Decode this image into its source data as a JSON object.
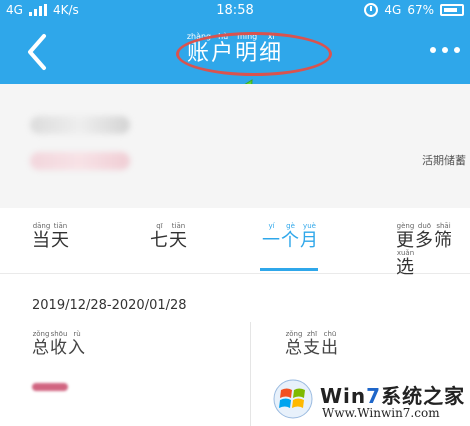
{
  "status_bar": {
    "network_left": "4G",
    "speed": "4K/s",
    "time": "18:58",
    "network_right": "4G",
    "battery": "67%"
  },
  "header": {
    "title": "账户明细",
    "title_pinyin": [
      "zhàng",
      "hù",
      "míng",
      "xì"
    ],
    "title_chars": [
      "账",
      "户",
      "明",
      "细"
    ],
    "accent": "#2fa7ea",
    "icons": {
      "back": "chevron-left-icon",
      "more": "more-dots-icon"
    }
  },
  "account_card": {
    "label": "活期储蓄"
  },
  "tabs": [
    {
      "chars": [
        "当",
        "天"
      ],
      "pinyin": [
        "dāng",
        "tiān"
      ]
    },
    {
      "chars": [
        "七",
        "天"
      ],
      "pinyin": [
        "qī",
        "tiān"
      ]
    },
    {
      "chars": [
        "一",
        "个",
        "月"
      ],
      "pinyin": [
        "yí",
        "gè",
        "yuè"
      ],
      "active": true
    },
    {
      "chars": [
        "更",
        "多",
        "筛",
        "选"
      ],
      "pinyin": [
        "gèng",
        "duō",
        "shāi",
        "xuǎn"
      ]
    }
  ],
  "summary": {
    "date_range": "2019/12/28-2020/01/28",
    "income": {
      "chars": [
        "总",
        "收",
        "入"
      ],
      "pinyin": [
        "zǒng",
        "shōu",
        "rù"
      ]
    },
    "expense": {
      "chars": [
        "总",
        "支",
        "出"
      ],
      "pinyin": [
        "zǒng",
        "zhī",
        "chū"
      ]
    }
  },
  "annotation": {
    "ellipse_color": "#d9534f",
    "arrow_color": "#5bd633"
  },
  "watermark": {
    "title_prefix": "Win",
    "title_seven": "7",
    "title_suffix": "系统之家",
    "url": "Www.Winwin7.com"
  }
}
